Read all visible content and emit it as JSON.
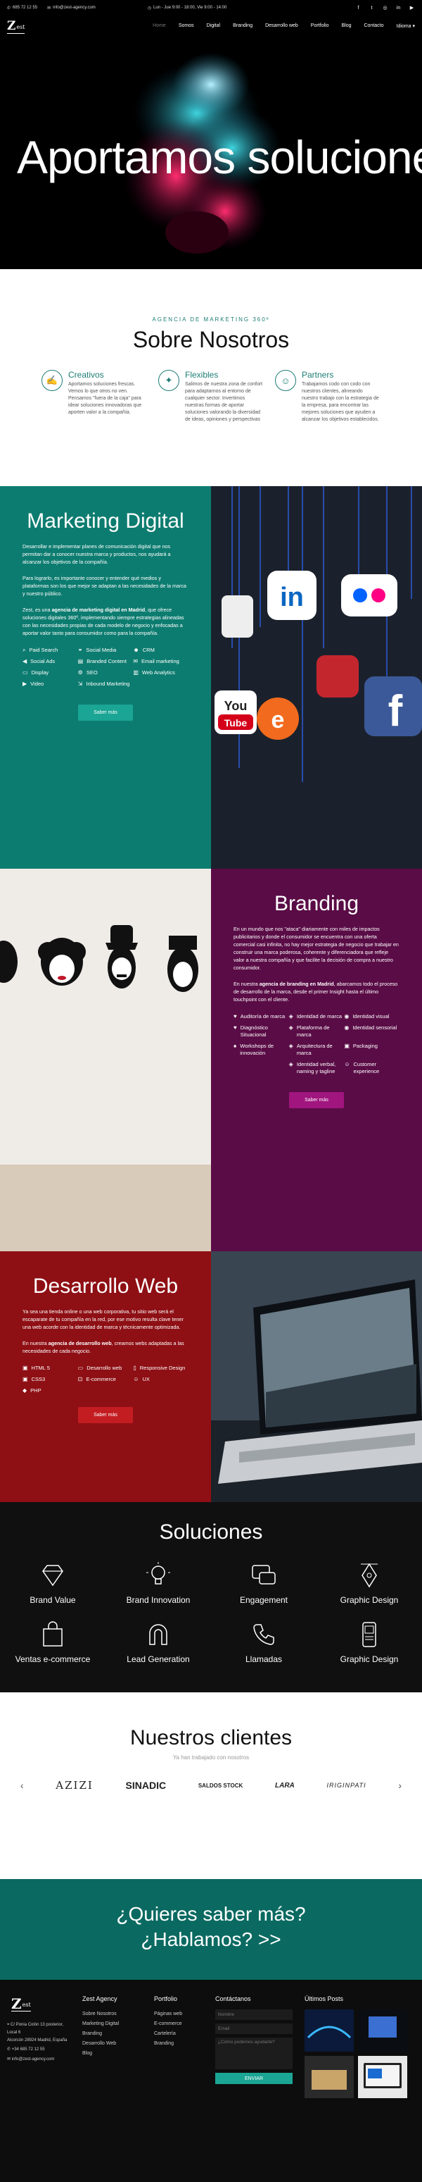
{
  "topbar": {
    "phone": "685 72 12 55",
    "email": "info@zest-agency.com",
    "hours": "Lun - Jue 9:00 - 18:00, Vie 9:00 - 14:00"
  },
  "nav": {
    "logo_main": "Z",
    "logo_sup": "est",
    "items": [
      "Home",
      "Somos",
      "Digital",
      "Branding",
      "Desarrollo web",
      "Portfolio",
      "Blog",
      "Contacto",
      "Idioma"
    ]
  },
  "hero": {
    "headline": "Aportamos soluciones"
  },
  "about": {
    "kicker": "AGENCIA DE MARKETING 360º",
    "title": "Sobre Nosotros",
    "features": [
      {
        "icon": "handshake-icon",
        "title": "Creativos",
        "text": "Aportamos soluciones frescas. Vemos lo que otros no ven. Pensamos \"fuera de la caja\" para idear soluciones innovadoras que aporten valor a la compañía."
      },
      {
        "icon": "puzzle-icon",
        "title": "Flexibles",
        "text": "Salimos de nuestra zona de confort para adaptarnos al entorno de cualquier sector. Invertimos nuestras formas de aportar soluciones valorando la diversidad de ideas, opiniones y perspectivas"
      },
      {
        "icon": "partners-icon",
        "title": "Partners",
        "text": "Trabajamos codo con codo con nuestros clientes, alineando nuestro trabajo con la estrategia de la empresa, para encontrar las mejores soluciones que ayuden a alcanzar los objetivos establecidos."
      }
    ]
  },
  "digital": {
    "title": "Marketing Digital",
    "p1": "Desarrollar e implementar planes de comunicación digital que nos permitan dar a conocer nuestra marca y productos, nos ayudará a alcanzar los objetivos de la compañía.",
    "p2": "Para lograrlo, es importante conocer y entender qué medios y plataformas son los que mejor se adaptan a las necesidades de la marca y nuestro público.",
    "p3a": "Zest, es una ",
    "p3b": "agencia de marketing digital en Madrid",
    "p3c": ", que ofrece soluciones digitales 360º, implementando siempre estrategias alineadas con las necesidades propias de cada modelo de negocio y enfocadas a aportar valor tanto para consumidor como para la compañía.",
    "items": [
      "Paid Search",
      "Social Media",
      "CRM",
      "Social Ads",
      "Branded Content",
      "Email marketing",
      "Display",
      "SEO",
      "Web Analytics",
      "Video",
      "Inbound Marketing"
    ],
    "button": "Saber más"
  },
  "branding": {
    "title": "Branding",
    "p1": "En un mundo que nos \"ataca\" diariamente con miles de impactos publicitarios y donde el consumidor se encuentra con una oferta comercial casi infinita, no hay mejor estrategia de negocio que trabajar en construir una marca poderosa, coherente y diferenciadora que refleje valor a nuestra compañía y que facilite la decisión de compra a nuestro consumidor.",
    "p2a": "En nuestra ",
    "p2b": "agencia de branding en Madrid",
    "p2c": ", abarcamos todo el proceso de desarrollo de la marca, desde el primer Insight hasta el último touchpoint con el cliente.",
    "items": [
      "Auditoría de marca",
      "Identidad de marca",
      "Identidad visual",
      "Diagnóstico Situacional",
      "Plataforma de marca",
      "Identidad sensorial",
      "Workshops de innovación",
      "Arquitectura de marca",
      "Packaging",
      "",
      "Identidad verbal, naming y tagline",
      "Customer experience"
    ],
    "button": "Saber más"
  },
  "web": {
    "title": "Desarrollo Web",
    "p1": "Ya sea una tienda online o una web corporativa, tu sitio web será el escaparate de tu compañía en la red, por ese motivo resulta clave tener una web acorde con la identidad de marca y técnicamente optimizada.",
    "p2a": "En nuestra ",
    "p2b": "agencia de desarrollo web",
    "p2c": ", creamos webs adaptadas a las necesidades de cada negocio.",
    "items": [
      "HTML 5",
      "Desarrollo web",
      "Responsive Design",
      "CSS3",
      "E-commerce",
      "UX",
      "PHP"
    ],
    "button": "Saber más"
  },
  "solutions": {
    "title": "Soluciones",
    "items": [
      {
        "label": "Brand Value",
        "icon": "diamond-icon"
      },
      {
        "label": "Brand Innovation",
        "icon": "lightbulb-icon"
      },
      {
        "label": "Engagement",
        "icon": "chat-icon"
      },
      {
        "label": "Graphic Design",
        "icon": "pen-nib-icon"
      },
      {
        "label": "Ventas e-commerce",
        "icon": "shopping-bag-icon"
      },
      {
        "label": "Lead Generation",
        "icon": "magnet-icon"
      },
      {
        "label": "Llamadas",
        "icon": "phone-icon"
      },
      {
        "label": "Graphic Design",
        "icon": "mobile-icon"
      }
    ]
  },
  "clients": {
    "title": "Nuestros clientes",
    "subtitle": "Ya han trabajado con nosotros",
    "logos": [
      "AZIZI",
      "SINADIC",
      "SALDOS STOCK",
      "LARA",
      "IRIGINPATI"
    ]
  },
  "cta": {
    "line1": "¿Quieres saber más?",
    "line2": "¿Hablamos? >>"
  },
  "footer": {
    "logo_main": "Z",
    "logo_sup": "est",
    "address": "C/ Ponia Colón 13 posterior, Local 6",
    "city": "Alcorcón 28924 Madrid, España",
    "phone": "+34 685 72 12 55",
    "email": "info@zest-agency.com",
    "col_agency_title": "Zest Agency",
    "col_agency": [
      "Sobre Nosotros",
      "Marketing Digital",
      "Branding",
      "Desarrollo Web",
      "Blog"
    ],
    "col_portfolio_title": "Portfolio",
    "col_portfolio": [
      "Páginas web",
      "E-commerce",
      "Cartelería",
      "Branding"
    ],
    "contact_title": "Contáctanos",
    "contact_name": "Nombre",
    "contact_email": "Email",
    "contact_msg": "¿Cómo podemos ayudarte?",
    "contact_button": "ENVIAR",
    "posts_title": "Últimos Posts"
  }
}
